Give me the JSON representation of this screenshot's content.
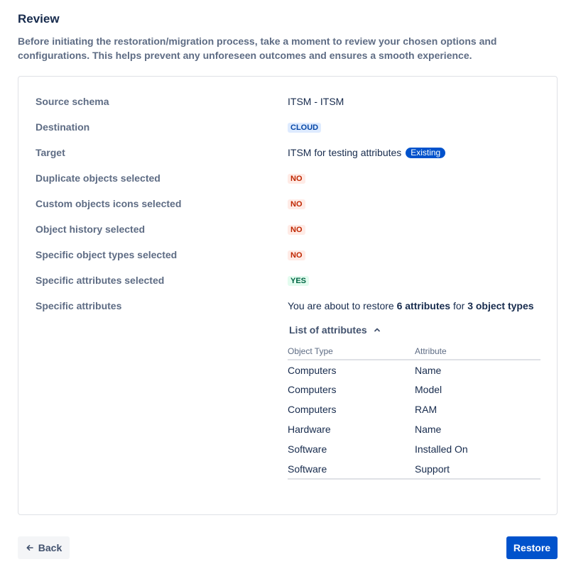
{
  "header": {
    "title": "Review",
    "description": "Before initiating the restoration/migration process, take a moment to review your chosen options and configurations. This helps prevent any unforeseen outcomes and ensures a smooth experience."
  },
  "review": {
    "source_schema": {
      "label": "Source schema",
      "value": "ITSM - ITSM"
    },
    "destination": {
      "label": "Destination",
      "value": "CLOUD"
    },
    "target": {
      "label": "Target",
      "value": "ITSM for testing attributes",
      "badge": "Existing"
    },
    "duplicate_objects": {
      "label": "Duplicate objects selected",
      "value": "NO"
    },
    "custom_icons": {
      "label": "Custom objects icons selected",
      "value": "NO"
    },
    "object_history": {
      "label": "Object history selected",
      "value": "NO"
    },
    "specific_object_types": {
      "label": "Specific object types selected",
      "value": "NO"
    },
    "specific_attributes_selected": {
      "label": "Specific attributes selected",
      "value": "YES"
    },
    "specific_attributes": {
      "label": "Specific attributes",
      "text_prefix": "You are about to restore ",
      "attr_count": "6 attributes",
      "text_middle": " for ",
      "type_count": "3 object types"
    }
  },
  "attributes_list": {
    "toggle_label": "List of attributes",
    "columns": [
      "Object Type",
      "Attribute"
    ],
    "rows": [
      [
        "Computers",
        "Name"
      ],
      [
        "Computers",
        "Model"
      ],
      [
        "Computers",
        "RAM"
      ],
      [
        "Hardware",
        "Name"
      ],
      [
        "Software",
        "Installed On"
      ],
      [
        "Software",
        "Support"
      ]
    ]
  },
  "footer": {
    "back_label": "Back",
    "restore_label": "Restore"
  },
  "colors": {
    "primary": "#0052cc",
    "text": "#172b4d",
    "subtle": "#5e6c84",
    "danger_bg": "#ffebe6",
    "danger_text": "#bf2600",
    "success_bg": "#e3fcef",
    "success_text": "#006644",
    "info_bg": "#deebff",
    "info_text": "#0747a6"
  },
  "icons": {
    "toggle": "chevron-up-icon",
    "back": "arrow-left-icon"
  }
}
